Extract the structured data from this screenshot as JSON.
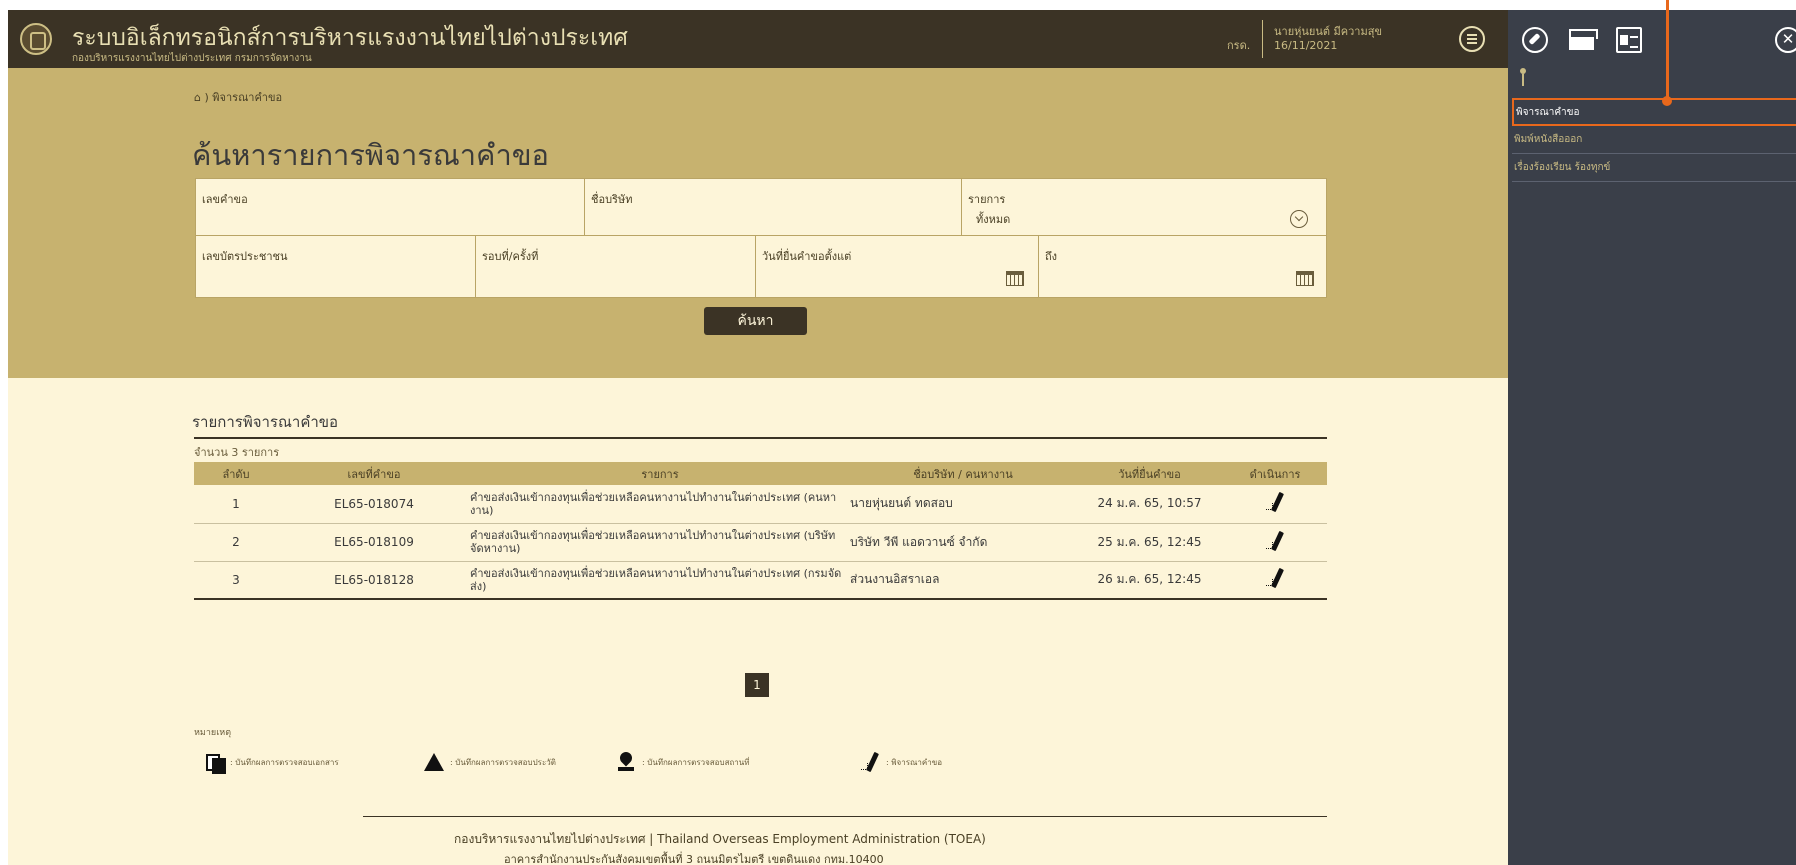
{
  "header": {
    "title": "ระบบอิเล็กทรอนิกส์การบริหารแรงงานไทยไปต่างประเทศ",
    "subtitle": "กองบริหารแรงงานไทยไปต่างประเทศ กรมการจัดหางาน",
    "org_code": "กรด.",
    "user_name": "นายหุ่นยนต์ มีความสุข",
    "date": "16/11/2021",
    "menu_icon": "hamburger-circle-icon"
  },
  "breadcrumb": {
    "home_icon": "home-icon",
    "separator": ")",
    "current": "พิจารณาคำขอ"
  },
  "page_title": "ค้นหารายการพิจารณาคำขอ",
  "search_form": {
    "request_no_label": "เลขคำขอ",
    "company_label": "ชื่อบริษัท",
    "item_label": "รายการ",
    "item_value": "ทั้งหมด",
    "citizen_id_label": "เลขบัตรประชาชน",
    "round_label": "รอบที่/ครั้งที่",
    "date_from_label": "วันที่ยื่นคำขอตั้งแต่",
    "date_to_label": "ถึง",
    "search_button": "ค้นหา"
  },
  "results": {
    "title": "รายการพิจารณาคำขอ",
    "count_text": "จำนวน 3 รายการ",
    "columns": [
      "ลำดับ",
      "เลขที่คำขอ",
      "รายการ",
      "ชื่อบริษัท / คนหางาน",
      "วันที่ยื่นคำขอ",
      "ดำเนินการ"
    ],
    "rows": [
      {
        "no": "1",
        "request_no": "EL65-018074",
        "item": "คำขอส่งเงินเข้ากองทุนเพื่อช่วยเหลือคนหางานไปทำงานในต่างประเทศ (คนหางาน)",
        "name": "นายหุ่นยนต์ ทดสอบ",
        "date": "24 ม.ค. 65, 10:57"
      },
      {
        "no": "2",
        "request_no": "EL65-018109",
        "item": "คำขอส่งเงินเข้ากองทุนเพื่อช่วยเหลือคนหางานไปทำงานในต่างประเทศ (บริษัทจัดหางาน)",
        "name": "บริษัท วีพี แอดวานซ์ จำกัด",
        "date": "25 ม.ค. 65, 12:45"
      },
      {
        "no": "3",
        "request_no": "EL65-018128",
        "item": "คำขอส่งเงินเข้ากองทุนเพื่อช่วยเหลือคนหางานไปทำงานในต่างประเทศ (กรมจัดส่ง)",
        "name": "ส่วนงานอิสราเอล",
        "date": "26 ม.ค. 65, 12:45"
      }
    ]
  },
  "pagination": {
    "current_page": "1"
  },
  "legend": {
    "title": "หมายเหตุ",
    "items": [
      {
        "icon": "document-check-icon",
        "label": ": บันทึกผลการตรวจสอบเอกสาร"
      },
      {
        "icon": "warning-icon",
        "label": ": บันทึกผลการตรวจสอบประวัติ"
      },
      {
        "icon": "location-pin-icon",
        "label": ": บันทึกผลการตรวจสอบสถานที่"
      },
      {
        "icon": "pen-icon",
        "label": ": พิจารณาคำขอ"
      }
    ]
  },
  "footer": {
    "line1": "กองบริหารแรงงานไทยไปต่างประเทศ | Thailand Overseas Employment Administration (TOEA)",
    "line2": "อาคารสำนักงานประกันสังคมเขตพื้นที่ 3 ถนนมิตรไมตรี เขตดินแดง กทม.10400"
  },
  "side_panel": {
    "icons": [
      "compass-icon",
      "inbox-icon",
      "id-card-icon",
      "close-icon"
    ],
    "close_glyph": "✕",
    "items": [
      "พิจารณาคำขอ",
      "พิมพ์หนังสือออก",
      "เรื่องร้องเรียน ร้องทุกข์"
    ]
  },
  "colors": {
    "top_bar": "#3b3325",
    "search_area": "#c7b26f",
    "page_bg": "#fdf5d9",
    "side_panel": "#3a3f49",
    "highlight": "#e8681c"
  }
}
